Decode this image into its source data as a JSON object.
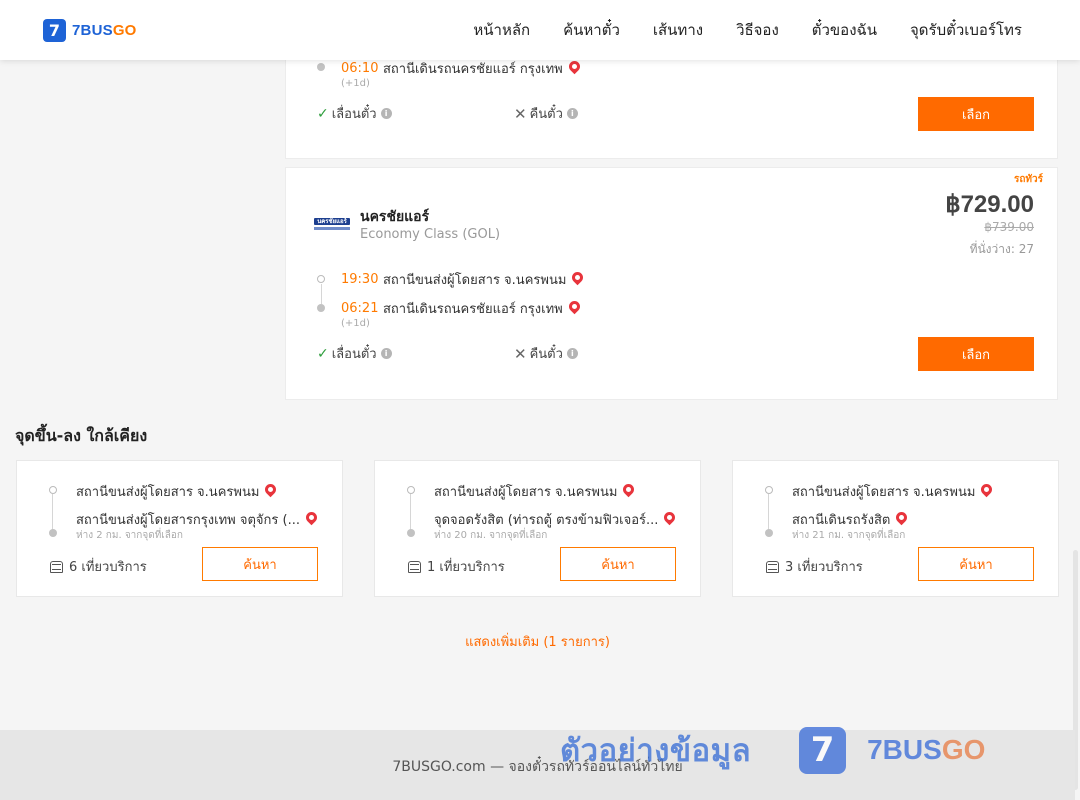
{
  "header": {
    "logo_mark": "7",
    "logo_brand": "7BUS",
    "logo_brand_accent": "GO",
    "nav": [
      "หน้าหลัก",
      "ค้นหาตั๋ว",
      "เส้นทาง",
      "วิธีจอง",
      "ตั๋วของฉัน",
      "จุดรับตั๋วเบอร์โทร"
    ]
  },
  "trip_top": {
    "arrival_time": "06:10",
    "arrival_station": "สถานีเดินรถนครชัยแอร์ กรุงเทพ",
    "plus_day": "(+1d)",
    "change_label": "เลื่อนตั๋ว",
    "refund_label": "คืนตั๋ว",
    "select_label": "เลือก"
  },
  "trip_main": {
    "tag": "รถทัวร์",
    "operator_logo_text": "นครชัยแอร์",
    "operator": "นครชัยแอร์",
    "class": "Economy Class (GOL)",
    "price": "฿729.00",
    "old_price": "฿739.00",
    "seats": "ที่นั่งว่าง: 27",
    "departure_time": "19:30",
    "departure_station": "สถานีขนส่งผู้โดยสาร จ.นครพนม",
    "arrival_time": "06:21",
    "arrival_station": "สถานีเดินรถนครชัยแอร์ กรุงเทพ",
    "plus_day": "(+1d)",
    "change_label": "เลื่อนตั๋ว",
    "refund_label": "คืนตั๋ว",
    "select_label": "เลือก"
  },
  "nearby": {
    "title": "จุดขึ้น-ลง ใกล้เคียง",
    "cards": [
      {
        "from": "สถานีขนส่งผู้โดยสาร จ.นครพนม",
        "to": "สถานีขนส่งผู้โดยสารกรุงเทพ จตุจักร (...",
        "distance": "ห่าง 2 กม. จากจุดที่เลือก",
        "trips": "6 เที่ยวบริการ",
        "button": "ค้นหา"
      },
      {
        "from": "สถานีขนส่งผู้โดยสาร จ.นครพนม",
        "to": "จุดจอดรังสิต (ท่ารถตู้ ตรงข้ามฟิวเจอร์...",
        "distance": "ห่าง 20 กม. จากจุดที่เลือก",
        "trips": "1 เที่ยวบริการ",
        "button": "ค้นหา"
      },
      {
        "from": "สถานีขนส่งผู้โดยสาร จ.นครพนม",
        "to": "สถานีเดินรถรังสิต",
        "distance": "ห่าง 21 กม. จากจุดที่เลือก",
        "trips": "3 เที่ยวบริการ",
        "button": "ค้นหา"
      }
    ],
    "show_more": "แสดงเพิ่มเติม (1 รายการ)"
  },
  "footer": {
    "text": "7BUSGO.com — จองตั๋วรถทัวร์ออนไลน์ทั่วไทย"
  },
  "watermark": {
    "text": "ตัวอย่างข้อมูล",
    "badge": "7",
    "brand": "7BUS",
    "brand_accent": "GO"
  },
  "colors": {
    "accent": "#ff6a00",
    "brand_blue": "#1e63d6",
    "pin": "#e8343c"
  }
}
